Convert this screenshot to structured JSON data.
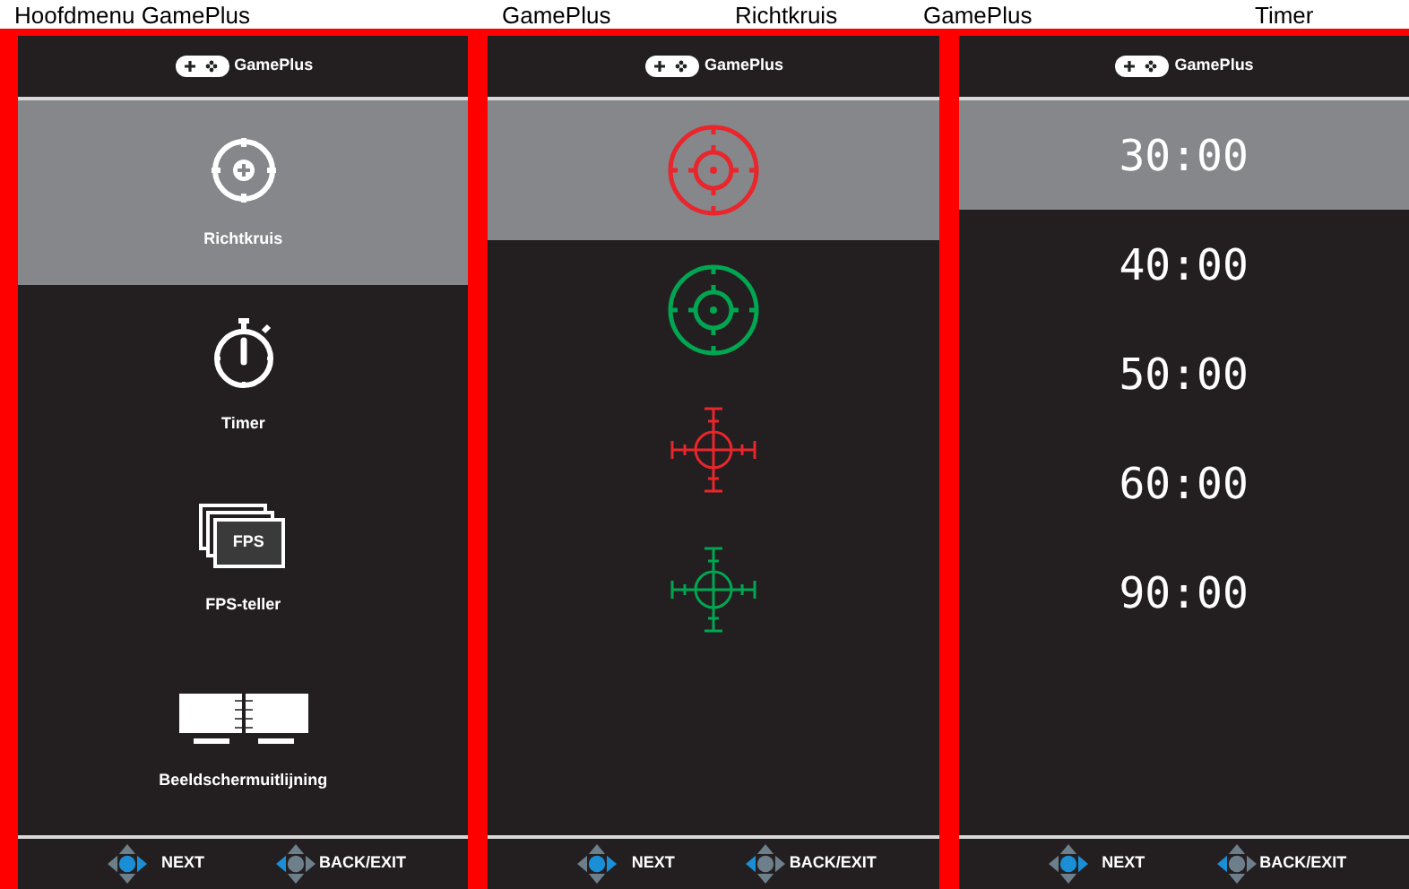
{
  "captions": [
    "Hoofdmenu GamePlus",
    "GamePlus",
    "Richtkruis",
    "GamePlus",
    "Timer"
  ],
  "panels": [
    {
      "header": "GamePlus",
      "kind": "menu",
      "items": [
        {
          "kind": "crosshair",
          "label": "Richtkruis",
          "selected": true
        },
        {
          "kind": "timer",
          "label": "Timer",
          "selected": false
        },
        {
          "kind": "fps",
          "label": "FPS-teller",
          "badge": "FPS",
          "selected": false
        },
        {
          "kind": "align",
          "label": "Beeldschermuitlijning",
          "selected": false
        }
      ],
      "footer": {
        "next": "NEXT",
        "back": "BACK/EXIT"
      }
    },
    {
      "header": "GamePlus",
      "kind": "crosshairs",
      "items": [
        {
          "kind": "ring",
          "color": "#e8262b",
          "selected": true
        },
        {
          "kind": "ring",
          "color": "#00a651",
          "selected": false
        },
        {
          "kind": "cross",
          "color": "#e8262b",
          "selected": false
        },
        {
          "kind": "cross",
          "color": "#00a651",
          "selected": false
        }
      ],
      "footer": {
        "next": "NEXT",
        "back": "BACK/EXIT"
      }
    },
    {
      "header": "GamePlus",
      "kind": "timers",
      "items": [
        {
          "label": "30:00",
          "selected": true
        },
        {
          "label": "40:00",
          "selected": false
        },
        {
          "label": "50:00",
          "selected": false
        },
        {
          "label": "60:00",
          "selected": false
        },
        {
          "label": "90:00",
          "selected": false
        }
      ],
      "footer": {
        "next": "NEXT",
        "back": "BACK/EXIT"
      }
    }
  ]
}
